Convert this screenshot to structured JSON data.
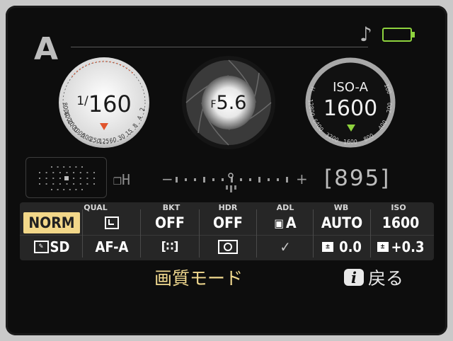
{
  "mode": "A",
  "shutter": {
    "prefix": "1/",
    "value": "160",
    "scale": [
      "8000",
      "4000",
      "2000",
      "1000",
      "500",
      "250",
      "125",
      "60",
      "30",
      "15",
      "8",
      "4",
      "2"
    ]
  },
  "aperture": {
    "prefix": "F",
    "value": "5.6"
  },
  "iso": {
    "label": "ISO-A",
    "value": "1600",
    "scale": [
      "H",
      "12800",
      "6400",
      "3200",
      "1600",
      "800",
      "400",
      "200",
      "100"
    ]
  },
  "drive": "❐H",
  "meter": {
    "minus": "−",
    "plus": "+"
  },
  "frames_remaining": "[895]",
  "panel": {
    "captions": [
      "QUAL",
      "BKT",
      "HDR",
      "ADL",
      "WB",
      "ISO"
    ],
    "row1": [
      "NORM",
      "",
      "OFF",
      "OFF",
      "A",
      "AUTO",
      "1600"
    ],
    "row2": [
      "SD",
      "AF-A",
      "",
      "",
      "",
      "0.0",
      "+0.3"
    ]
  },
  "bottom_label": "画質モード",
  "back": {
    "icon": "i",
    "label": "戻る"
  },
  "colors": {
    "accent": "#f2d789",
    "battery": "#8ed33e",
    "meter_indicator": "#8ed33e",
    "shutter_marker": "#e0542c"
  }
}
